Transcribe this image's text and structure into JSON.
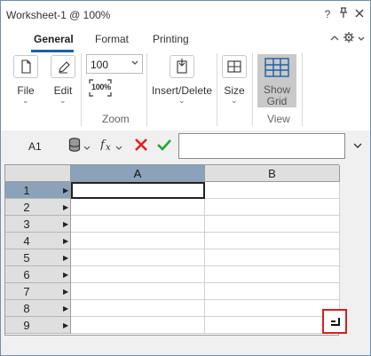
{
  "window": {
    "title": "Worksheet-1 @ 100%"
  },
  "title_buttons": [
    "?",
    "⊟",
    "✕"
  ],
  "ribbon": {
    "tabs": [
      "General",
      "Format",
      "Printing"
    ],
    "active_tab": "General",
    "buttons": {
      "file": "File",
      "edit": "Edit",
      "insert_delete": "Insert/Delete",
      "size": "Size",
      "show_grid_line1": "Show",
      "show_grid_line2": "Grid"
    },
    "zoom": {
      "value": "100",
      "badge": "100%",
      "group_label": "Zoom"
    },
    "view_group_label": "View"
  },
  "formula_bar": {
    "cell_ref": "A1",
    "formula_value": ""
  },
  "grid": {
    "columns": [
      "A",
      "B"
    ],
    "rows": [
      "1",
      "2",
      "3",
      "4",
      "5",
      "6",
      "7",
      "8",
      "9"
    ],
    "selected_cell": "A1"
  },
  "colors": {
    "accent": "#1f5fa8",
    "header_selected": "#8aa2ba",
    "cancel_red": "#e02020",
    "confirm_green": "#22a832",
    "highlight_red": "#d42020"
  }
}
